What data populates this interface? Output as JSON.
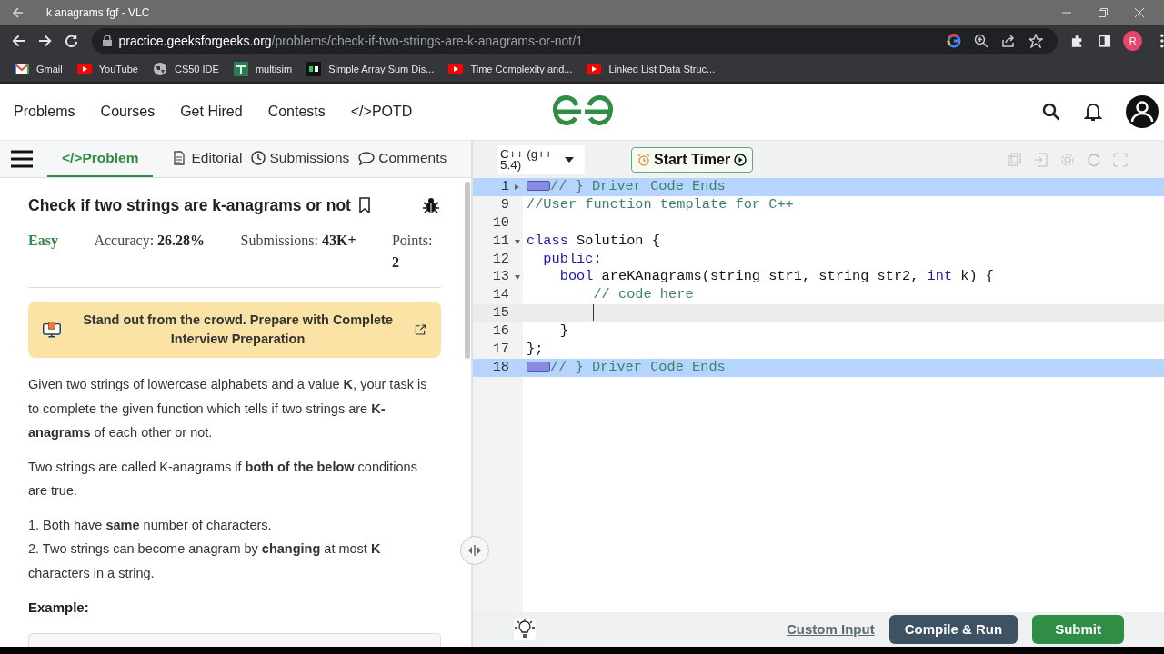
{
  "window": {
    "title": "k anagrams fgf - VLC"
  },
  "browser": {
    "url_host": "practice.geeksforgeeks.org",
    "url_path": "/problems/check-if-two-strings-are-k-anagrams-or-not/1",
    "profile_initial": "R"
  },
  "bookmarks": [
    {
      "label": "Gmail",
      "kind": "mail"
    },
    {
      "label": "YouTube",
      "kind": "video"
    },
    {
      "label": "CS50 IDE",
      "kind": "globe"
    },
    {
      "label": "multisim",
      "kind": "tiles"
    },
    {
      "label": "Simple Array Sum Dis...",
      "kind": "square"
    },
    {
      "label": "Time Complexity and...",
      "kind": "video"
    },
    {
      "label": "Linked List Data Struc...",
      "kind": "video"
    }
  ],
  "site_nav": {
    "links": [
      "Problems",
      "Courses",
      "Get Hired",
      "Contests",
      "</>POTD"
    ]
  },
  "tabs": [
    {
      "label": "</>Problem",
      "selected": true
    },
    {
      "label": "Editorial",
      "kind": "document",
      "selected": false
    },
    {
      "label": "Submissions",
      "kind": "clock",
      "selected": false
    },
    {
      "label": "Comments",
      "kind": "comment",
      "selected": false
    }
  ],
  "problem": {
    "title": "Check if two strings are k-anagrams or not",
    "difficulty": "Easy",
    "stats": [
      {
        "label": "Accuracy:",
        "value": "26.28%"
      },
      {
        "label": "Submissions:",
        "value": "43K+"
      },
      {
        "label": "Points:",
        "value": "2"
      }
    ],
    "banner": "Stand out from the crowd. Prepare with Complete Interview Preparation",
    "description": [
      {
        "kind": "paragraph",
        "text": "Given two strings of lowercase alphabets and a value **K**, your task is to complete the given function which tells if  two strings are **K-anagrams** of each other or not."
      },
      {
        "kind": "paragraph",
        "text": "Two strings are called K-anagrams if **both of the below** conditions are true."
      },
      {
        "kind": "line",
        "text": "1. Both have **same** number of characters."
      },
      {
        "kind": "line",
        "text": "2. Two strings can become anagram by **changing** at most **K** characters in a string."
      }
    ],
    "example_heading": "Example:"
  },
  "editor": {
    "language": "C++ (g++ 5.4)",
    "timer_label": "Start Timer",
    "lines": [
      {
        "number": "1",
        "collapsed": true,
        "highlighted": true,
        "widget": true,
        "tokens": [
          {
            "text": "// } Driver Code Ends",
            "kind": "comment"
          }
        ]
      },
      {
        "number": "9",
        "tokens": [
          {
            "text": "//User function template for C++",
            "kind": "comment"
          }
        ]
      },
      {
        "number": "10"
      },
      {
        "number": "11",
        "collapsed": false,
        "tokens": [
          {
            "text": "class",
            "kind": "keyword"
          },
          {
            "text": " Solution {",
            "kind": "plain"
          }
        ],
        "children": [
          {
            "number": "12",
            "tokens": [
              {
                "text": "public",
                "kind": "keyword"
              },
              {
                "text": ":",
                "kind": "plain"
              }
            ],
            "children": [
              {
                "number": "13",
                "collapsed": false,
                "tokens": [
                  {
                    "text": "bool",
                    "kind": "keyword"
                  },
                  {
                    "text": " areKAnagrams(string str1, string str2, ",
                    "kind": "plain"
                  },
                  {
                    "text": "int",
                    "kind": "keyword"
                  },
                  {
                    "text": " k) {",
                    "kind": "plain"
                  }
                ],
                "children": [
                  {
                    "number": "14",
                    "tokens": [
                      {
                        "text": "// code here",
                        "kind": "comment"
                      }
                    ]
                  },
                  {
                    "number": "15",
                    "current": true
                  }
                ]
              },
              {
                "number": "16",
                "tokens": [
                  {
                    "text": "}",
                    "kind": "plain"
                  }
                ]
              }
            ]
          }
        ]
      },
      {
        "number": "17",
        "tokens": [
          {
            "text": "};",
            "kind": "plain"
          }
        ]
      },
      {
        "number": "18",
        "highlighted": true,
        "widget": true,
        "tokens": [
          {
            "text": "// } Driver Code Ends",
            "kind": "comment"
          }
        ]
      }
    ]
  },
  "footer": {
    "custom_input": "Custom Input",
    "compile": "Compile & Run",
    "submit": "Submit"
  }
}
